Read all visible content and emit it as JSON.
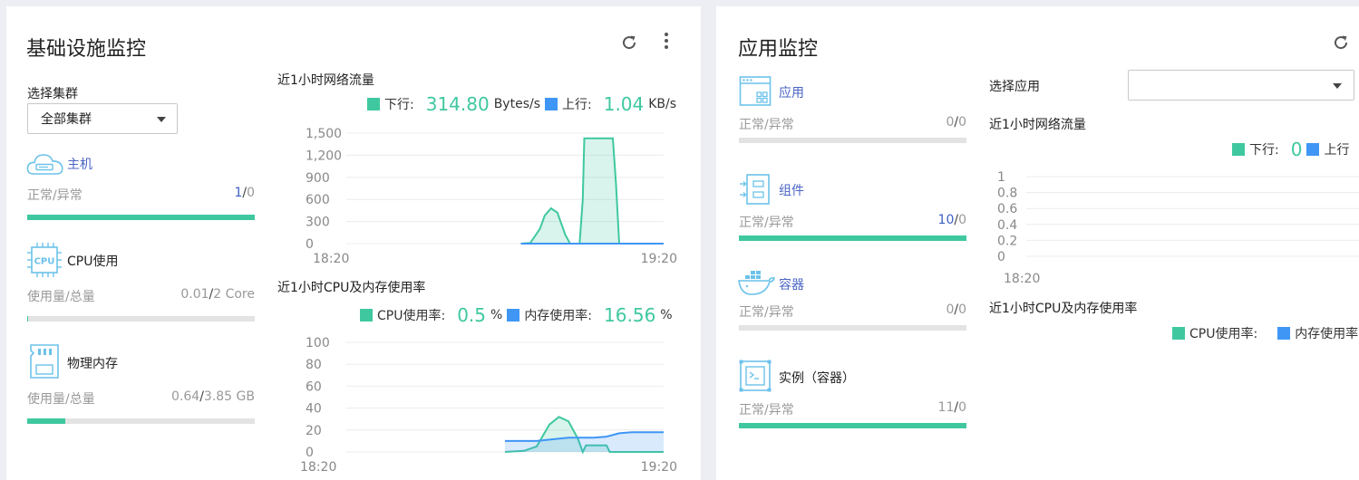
{
  "infra": {
    "title": "基础设施监控",
    "cluster": {
      "label": "选择集群",
      "value": "全部集群"
    },
    "hosts": {
      "label": "主机",
      "sub": "正常/异常",
      "normal": "1",
      "sep": "/",
      "abnormal": "0",
      "ratio": 1.0
    },
    "cpu": {
      "label": "CPU使用",
      "sub": "使用量/总量",
      "used": "0.01",
      "sep": "/",
      "total": "2 Core",
      "ratio": 0.005
    },
    "mem": {
      "label": "物理内存",
      "sub": "使用量/总量",
      "used": "0.64",
      "sep": "/",
      "total": "3.85 GB",
      "ratio": 0.166
    },
    "net": {
      "title": "近1小时网络流量",
      "down_label": "下行:",
      "down_value": "314.80",
      "down_unit": "Bytes/s",
      "up_label": "上行:",
      "up_value": "1.04",
      "up_unit": "KB/s"
    },
    "cpumem": {
      "title": "近1小时CPU及内存使用率",
      "cpu_label": "CPU使用率:",
      "cpu_value": "0.5",
      "cpu_unit": "%",
      "mem_label": "内存使用率:",
      "mem_value": "16.56",
      "mem_unit": "%"
    }
  },
  "app": {
    "title": "应用监控",
    "items": [
      {
        "label": "应用",
        "sub": "正常/异常",
        "normal": "0",
        "sep": "/",
        "abnormal": "0",
        "ratio": 0
      },
      {
        "label": "组件",
        "sub": "正常/异常",
        "normal": "10",
        "sep": "/",
        "abnormal": "0",
        "ratio": 1.0
      },
      {
        "label": "容器",
        "sub": "正常/异常",
        "normal": "0",
        "sep": "/",
        "abnormal": "0",
        "ratio": 0
      },
      {
        "label": "实例（容器）",
        "sub": "正常/异常",
        "normal": "11",
        "sep": "/",
        "abnormal": "0",
        "ratio": 1.0
      }
    ],
    "select": {
      "label": "选择应用",
      "value": ""
    },
    "net": {
      "title": "近1小时网络流量",
      "down_label": "下行:",
      "down_value": "0",
      "up_label": "上行"
    },
    "cpumem": {
      "title": "近1小时CPU及内存使用率",
      "cpu_label": "CPU使用率:",
      "mem_label": "内存使用率"
    }
  },
  "icons": {
    "refresh": "refresh-icon",
    "more": "more-vertical-icon",
    "host": "cloud-host-icon",
    "cpu": "cpu-chip-icon",
    "memory": "memory-card-icon",
    "app": "application-window-icon",
    "component": "component-icon",
    "container": "docker-whale-icon",
    "instance": "instance-terminal-icon"
  },
  "colors": {
    "accent_green": "#3fc8a0",
    "accent_blue": "#3f96f5",
    "link_blue": "#4a64c4",
    "icon_blue": "#6cc2ea"
  },
  "chart_data": [
    {
      "type": "area",
      "title": "近1小时网络流量",
      "x": [
        "18:20",
        "19:20"
      ],
      "ylim": [
        0,
        1500
      ],
      "yticks": [
        0,
        300,
        600,
        900,
        1200,
        1500
      ],
      "grid": true,
      "series": [
        {
          "name": "下行",
          "color": "#3fc8a0",
          "points": [
            [
              0.55,
              0
            ],
            [
              0.58,
              10
            ],
            [
              0.61,
              200
            ],
            [
              0.625,
              380
            ],
            [
              0.645,
              480
            ],
            [
              0.665,
              420
            ],
            [
              0.69,
              120
            ],
            [
              0.705,
              0
            ],
            [
              0.735,
              0
            ],
            [
              0.745,
              600
            ],
            [
              0.75,
              1430
            ],
            [
              0.84,
              1430
            ],
            [
              0.85,
              800
            ],
            [
              0.86,
              0
            ],
            [
              1.0,
              0
            ]
          ]
        },
        {
          "name": "上行",
          "color": "#3f96f5",
          "points": [
            [
              0.55,
              0
            ],
            [
              1.0,
              0
            ]
          ]
        }
      ]
    },
    {
      "type": "area",
      "title": "近1小时CPU及内存使用率",
      "x": [
        "18:20",
        "19:20"
      ],
      "ylim": [
        0,
        100
      ],
      "yticks": [
        0,
        20,
        40,
        60,
        80,
        100
      ],
      "grid": true,
      "series": [
        {
          "name": "CPU使用率",
          "color": "#3fc8a0",
          "points": [
            [
              0.5,
              0
            ],
            [
              0.56,
              1
            ],
            [
              0.6,
              5
            ],
            [
              0.64,
              25
            ],
            [
              0.67,
              32
            ],
            [
              0.7,
              28
            ],
            [
              0.73,
              12
            ],
            [
              0.745,
              0
            ],
            [
              0.755,
              6
            ],
            [
              0.78,
              6
            ],
            [
              0.82,
              6
            ],
            [
              0.83,
              0
            ],
            [
              1.0,
              0
            ]
          ]
        },
        {
          "name": "内存使用率",
          "color": "#3f96f5",
          "points": [
            [
              0.5,
              10
            ],
            [
              0.6,
              10
            ],
            [
              0.7,
              13
            ],
            [
              0.78,
              13
            ],
            [
              0.82,
              14
            ],
            [
              0.86,
              17
            ],
            [
              0.9,
              18
            ],
            [
              1.0,
              18
            ]
          ]
        }
      ]
    },
    {
      "type": "line",
      "title": "近1小时网络流量",
      "x": [
        "18:20"
      ],
      "ylim": [
        0,
        1
      ],
      "yticks": [
        0,
        0.2,
        0.4,
        0.6,
        0.8,
        1
      ],
      "grid": true,
      "series": []
    }
  ]
}
